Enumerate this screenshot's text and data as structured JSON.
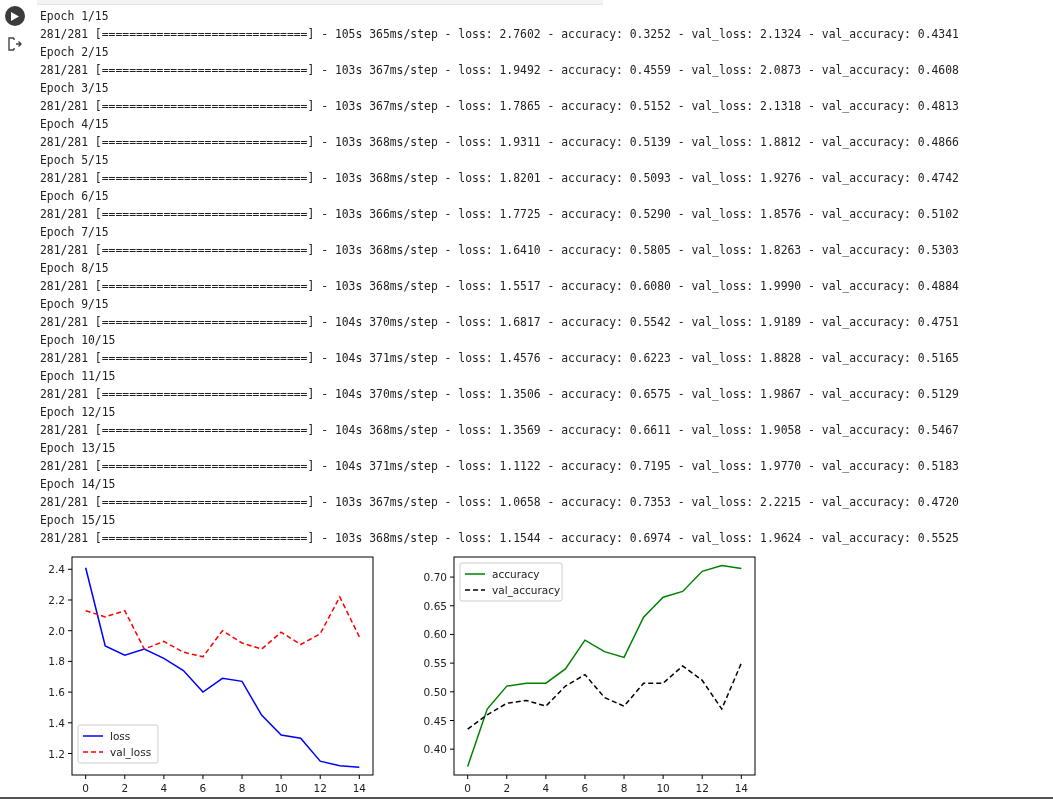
{
  "output": {
    "epochs": [
      {
        "title": "Epoch 1/15",
        "progress": "281/281 [==============================] - 105s 365ms/step - loss: 2.7602 - accuracy: 0.3252 - val_loss: 2.1324 - val_accuracy: 0.4341"
      },
      {
        "title": "Epoch 2/15",
        "progress": "281/281 [==============================] - 103s 367ms/step - loss: 1.9492 - accuracy: 0.4559 - val_loss: 2.0873 - val_accuracy: 0.4608"
      },
      {
        "title": "Epoch 3/15",
        "progress": "281/281 [==============================] - 103s 367ms/step - loss: 1.7865 - accuracy: 0.5152 - val_loss: 2.1318 - val_accuracy: 0.4813"
      },
      {
        "title": "Epoch 4/15",
        "progress": "281/281 [==============================] - 103s 368ms/step - loss: 1.9311 - accuracy: 0.5139 - val_loss: 1.8812 - val_accuracy: 0.4866"
      },
      {
        "title": "Epoch 5/15",
        "progress": "281/281 [==============================] - 103s 368ms/step - loss: 1.8201 - accuracy: 0.5093 - val_loss: 1.9276 - val_accuracy: 0.4742"
      },
      {
        "title": "Epoch 6/15",
        "progress": "281/281 [==============================] - 103s 366ms/step - loss: 1.7725 - accuracy: 0.5290 - val_loss: 1.8576 - val_accuracy: 0.5102"
      },
      {
        "title": "Epoch 7/15",
        "progress": "281/281 [==============================] - 103s 368ms/step - loss: 1.6410 - accuracy: 0.5805 - val_loss: 1.8263 - val_accuracy: 0.5303"
      },
      {
        "title": "Epoch 8/15",
        "progress": "281/281 [==============================] - 103s 368ms/step - loss: 1.5517 - accuracy: 0.6080 - val_loss: 1.9990 - val_accuracy: 0.4884"
      },
      {
        "title": "Epoch 9/15",
        "progress": "281/281 [==============================] - 104s 370ms/step - loss: 1.6817 - accuracy: 0.5542 - val_loss: 1.9189 - val_accuracy: 0.4751"
      },
      {
        "title": "Epoch 10/15",
        "progress": "281/281 [==============================] - 104s 371ms/step - loss: 1.4576 - accuracy: 0.6223 - val_loss: 1.8828 - val_accuracy: 0.5165"
      },
      {
        "title": "Epoch 11/15",
        "progress": "281/281 [==============================] - 104s 370ms/step - loss: 1.3506 - accuracy: 0.6575 - val_loss: 1.9867 - val_accuracy: 0.5129"
      },
      {
        "title": "Epoch 12/15",
        "progress": "281/281 [==============================] - 104s 368ms/step - loss: 1.3569 - accuracy: 0.6611 - val_loss: 1.9058 - val_accuracy: 0.5467"
      },
      {
        "title": "Epoch 13/15",
        "progress": "281/281 [==============================] - 104s 371ms/step - loss: 1.1122 - accuracy: 0.7195 - val_loss: 1.9770 - val_accuracy: 0.5183"
      },
      {
        "title": "Epoch 14/15",
        "progress": "281/281 [==============================] - 103s 367ms/step - loss: 1.0658 - accuracy: 0.7353 - val_loss: 2.2215 - val_accuracy: 0.4720"
      },
      {
        "title": "Epoch 15/15",
        "progress": "281/281 [==============================] - 103s 368ms/step - loss: 1.1544 - accuracy: 0.6974 - val_loss: 1.9624 - val_accuracy: 0.5525"
      }
    ],
    "charts": [
      {
        "chart_data": {
          "type": "line",
          "x": [
            0,
            1,
            2,
            3,
            4,
            5,
            6,
            7,
            8,
            9,
            10,
            11,
            12,
            13,
            14
          ],
          "xlim": [
            -0.7,
            14.7
          ],
          "ylim": [
            1.06,
            2.48
          ],
          "xticks": [
            0,
            2,
            4,
            6,
            8,
            10,
            12,
            14
          ],
          "yticks": [
            {
              "value": 1.2,
              "label": "1.2"
            },
            {
              "value": 1.4,
              "label": "1.4"
            },
            {
              "value": 1.6,
              "label": "1.6"
            },
            {
              "value": 1.8,
              "label": "1.8"
            },
            {
              "value": 2.0,
              "label": "2.0"
            },
            {
              "value": 2.2,
              "label": "2.2"
            },
            {
              "value": 2.4,
              "label": "2.4"
            }
          ],
          "series": [
            {
              "name": "loss",
              "color": "#0000ff",
              "line_style": "solid",
              "values": [
                2.41,
                1.9,
                1.84,
                1.88,
                1.82,
                1.74,
                1.6,
                1.69,
                1.67,
                1.45,
                1.32,
                1.3,
                1.15,
                1.12,
                1.11
              ]
            },
            {
              "name": "val_loss",
              "color": "#ff0000",
              "line_style": "dashed",
              "values": [
                2.13,
                2.09,
                2.13,
                1.88,
                1.93,
                1.86,
                1.83,
                2.0,
                1.92,
                1.88,
                1.99,
                1.91,
                1.98,
                2.22,
                1.96
              ]
            }
          ],
          "legend": "lower left"
        }
      },
      {
        "chart_data": {
          "type": "line",
          "x": [
            0,
            1,
            2,
            3,
            4,
            5,
            6,
            7,
            8,
            9,
            10,
            11,
            12,
            13,
            14
          ],
          "xlim": [
            -0.7,
            14.7
          ],
          "ylim": [
            0.355,
            0.735
          ],
          "xticks": [
            0,
            2,
            4,
            6,
            8,
            10,
            12,
            14
          ],
          "yticks": [
            {
              "value": 0.4,
              "label": "0.40"
            },
            {
              "value": 0.45,
              "label": "0.45"
            },
            {
              "value": 0.5,
              "label": "0.50"
            },
            {
              "value": 0.55,
              "label": "0.55"
            },
            {
              "value": 0.6,
              "label": "0.60"
            },
            {
              "value": 0.65,
              "label": "0.65"
            },
            {
              "value": 0.7,
              "label": "0.70"
            }
          ],
          "series": [
            {
              "name": "accuracy",
              "color": "#008000",
              "line_style": "solid",
              "values": [
                0.37,
                0.47,
                0.51,
                0.515,
                0.515,
                0.54,
                0.59,
                0.57,
                0.56,
                0.63,
                0.665,
                0.675,
                0.71,
                0.72,
                0.715
              ]
            },
            {
              "name": "val_accuracy",
              "color": "#000000",
              "line_style": "dashed",
              "values": [
                0.435,
                0.46,
                0.48,
                0.485,
                0.475,
                0.51,
                0.53,
                0.49,
                0.475,
                0.515,
                0.515,
                0.545,
                0.52,
                0.47,
                0.55
              ]
            }
          ],
          "legend": "upper left"
        }
      }
    ]
  }
}
